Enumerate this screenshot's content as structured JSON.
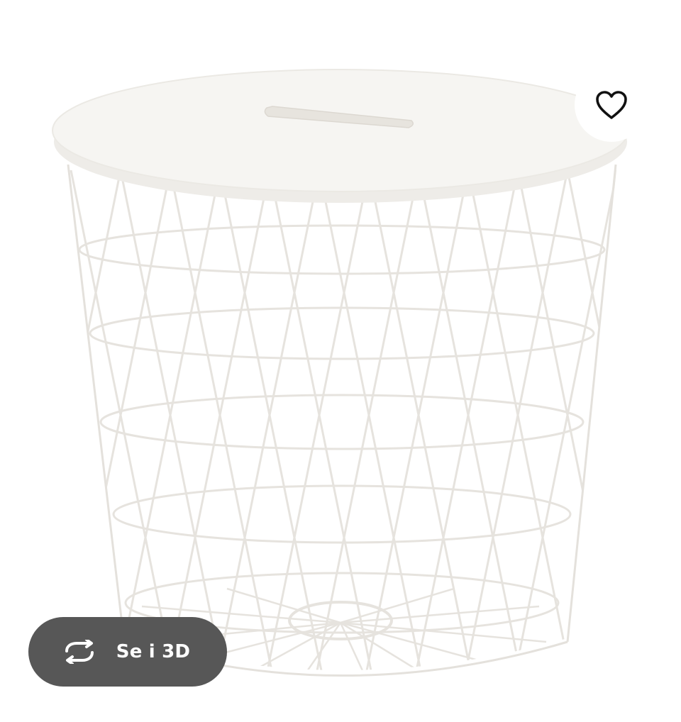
{
  "product": {
    "image_icon": "wire-basket-storage-table-image"
  },
  "favorite": {
    "icon": "heart-outline-icon"
  },
  "view_3d": {
    "label": "Se i 3D",
    "icon": "rotate-arrows-icon",
    "background": "#575757"
  },
  "colors": {
    "background": "#ffffff",
    "wire": "#e9e6e1"
  }
}
